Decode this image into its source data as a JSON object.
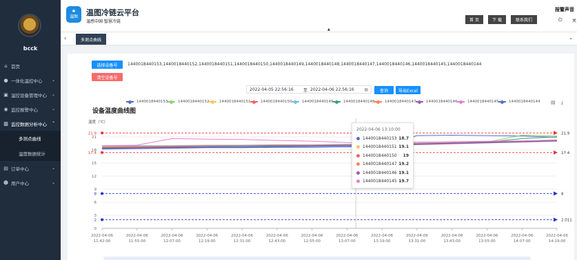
{
  "sidebar": {
    "username": "bcck",
    "items": [
      {
        "label": "首页",
        "icon": "home-icon"
      },
      {
        "label": "一体化温控中心",
        "icon": "info-icon"
      },
      {
        "label": "温控设备管理中心",
        "icon": "device-icon"
      },
      {
        "label": "监控报警中心",
        "icon": "alarm-icon"
      },
      {
        "label": "监控数据分析中心",
        "icon": "chart-icon"
      }
    ],
    "sub_items": [
      "多测点曲线",
      "温度数据统计"
    ],
    "items_after": [
      {
        "label": "订单中心",
        "icon": "order-icon"
      },
      {
        "label": "用户中心",
        "icon": "user-icon"
      }
    ]
  },
  "header": {
    "logo_text": "温图",
    "title": "温图冷链云平台",
    "subtitle": "温感中国 智慧冷链",
    "buttons": [
      "首 页",
      "下 载",
      "联系我们"
    ],
    "alarm_label": "报警声音",
    "alarm_sub": "关"
  },
  "tabs": {
    "active": "多测点曲线"
  },
  "controls": {
    "select_device": "选择设备号",
    "clear_device": "清空设备号",
    "devices": "1440018440153,1440018440152,1440018440151,1440018440150,1440018440149,1440018440148,1440018440147,1440018440146,1440018440145,1440018440144",
    "start_date": "2022-04-05 22:56:16",
    "end_date": "2022-04-06 22:56:16",
    "range_sep": "至",
    "query": "查询",
    "export": "导出Excel"
  },
  "legend": [
    {
      "name": "1440018440153",
      "color": "#5470c6"
    },
    {
      "name": "1440018440152",
      "color": "#91cc75"
    },
    {
      "name": "1440018440151",
      "color": "#fac858"
    },
    {
      "name": "1440018440150",
      "color": "#ee6666"
    },
    {
      "name": "1440018440149",
      "color": "#73c0de"
    },
    {
      "name": "1440018440148",
      "color": "#3ba272"
    },
    {
      "name": "1440018440147",
      "color": "#fc8452"
    },
    {
      "name": "1440018440146",
      "color": "#9a60b4"
    },
    {
      "name": "1440018440145",
      "color": "#ea7ccc"
    },
    {
      "name": "1440018440144",
      "color": "#5470c6"
    }
  ],
  "tooltip": {
    "title": "2022-04-06 13:10:00",
    "rows": [
      {
        "name": "1440018440153",
        "value": "18.7",
        "color": "#5470c6"
      },
      {
        "name": "1440018440151",
        "value": "19.1",
        "color": "#fac858"
      },
      {
        "name": "1440018440150",
        "value": "19",
        "color": "#ee6666"
      },
      {
        "name": "1440018440147",
        "value": "19.2",
        "color": "#fc8452"
      },
      {
        "name": "1440018440146",
        "value": "19.1",
        "color": "#9a60b4"
      },
      {
        "name": "1440018440145",
        "value": "19.7",
        "color": "#ea7ccc"
      }
    ]
  },
  "chart_data": {
    "type": "line",
    "title": "设备温度曲线图",
    "ylabel": "温度（℃）",
    "ylim": [
      0,
      24
    ],
    "yticks": [
      0,
      3,
      6,
      9,
      12,
      15,
      18,
      21
    ],
    "x": [
      "2022-04-06 11:42:00",
      "2022-04-06 11:55:00",
      "2022-04-06 12:07:00",
      "2022-04-06 12:19:00",
      "2022-04-06 12:31:00",
      "2022-04-06 12:43:00",
      "2022-04-06 12:55:00",
      "2022-04-06 13:07:00",
      "2022-04-06 13:19:00",
      "2022-04-06 13:31:00",
      "2022-04-06 13:43:00",
      "2022-04-06 13:55:00",
      "2022-04-06 14:07:00",
      "2022-04-06 14:19:00"
    ],
    "markLines": [
      {
        "left_label": "21.9",
        "right_label": "21.9",
        "value": 21.9,
        "color": "#ee3333"
      },
      {
        "left_label": "17.4",
        "right_label": "17.4",
        "value": 17.4,
        "color": "#ee3333"
      },
      {
        "left_label": "8",
        "right_label": "8",
        "value": 8,
        "color": "#2233cc"
      },
      {
        "left_label": "2",
        "right_label": "2.011",
        "value": 2,
        "color": "#2233cc"
      }
    ],
    "series": [
      {
        "name": "1440018440153",
        "color": "#5470c6",
        "values": [
          18.2,
          18.3,
          18.4,
          18.5,
          18.5,
          18.6,
          18.6,
          18.7,
          18.8,
          21.3,
          21.4,
          21.3,
          21.2,
          20.9
        ]
      },
      {
        "name": "1440018440152",
        "color": "#91cc75",
        "values": [
          18.5,
          18.6,
          18.7,
          18.8,
          18.9,
          19.0,
          19.1,
          19.2,
          19.3,
          19.4,
          19.6,
          19.8,
          21.4,
          21.2
        ]
      },
      {
        "name": "1440018440151",
        "color": "#fac858",
        "values": [
          18.8,
          18.9,
          19.0,
          19.0,
          19.0,
          19.1,
          19.1,
          19.1,
          19.2,
          19.3,
          19.5,
          19.7,
          19.9,
          20.1
        ]
      },
      {
        "name": "1440018440150",
        "color": "#ee6666",
        "values": [
          18.6,
          18.7,
          18.8,
          18.8,
          18.9,
          18.9,
          19.0,
          19.0,
          19.1,
          19.2,
          19.4,
          19.6,
          19.8,
          20.0
        ]
      },
      {
        "name": "1440018440149",
        "color": "#73c0de",
        "values": [
          18.9,
          19.0,
          19.0,
          19.1,
          19.1,
          19.2,
          19.2,
          19.3,
          19.4,
          19.6,
          19.7,
          19.9,
          20.0,
          20.2
        ]
      },
      {
        "name": "1440018440148",
        "color": "#3ba272",
        "values": [
          18.4,
          18.5,
          18.6,
          18.7,
          18.7,
          18.8,
          18.9,
          19.0,
          19.2,
          19.4,
          19.6,
          19.8,
          20.6,
          21.0
        ]
      },
      {
        "name": "1440018440147",
        "color": "#fc8452",
        "values": [
          18.7,
          18.8,
          18.9,
          19.0,
          19.0,
          19.1,
          19.1,
          19.2,
          19.3,
          19.5,
          19.7,
          19.8,
          20.0,
          20.2
        ]
      },
      {
        "name": "1440018440146",
        "color": "#9a60b4",
        "values": [
          18.5,
          18.6,
          18.7,
          18.8,
          18.9,
          19.0,
          19.0,
          19.1,
          19.2,
          19.4,
          19.6,
          19.8,
          19.9,
          20.1
        ]
      },
      {
        "name": "1440018440145",
        "color": "#ea7ccc",
        "values": [
          19.0,
          19.1,
          20.6,
          20.5,
          20.4,
          20.2,
          20.0,
          19.7,
          19.6,
          19.8,
          19.9,
          20.0,
          20.1,
          20.3
        ]
      },
      {
        "name": "1440018440144",
        "color": "#5470c6",
        "values": [
          18.3,
          18.4,
          18.5,
          18.6,
          18.6,
          18.7,
          18.8,
          18.9,
          19.0,
          19.3,
          19.5,
          19.7,
          19.9,
          20.1
        ]
      }
    ]
  }
}
